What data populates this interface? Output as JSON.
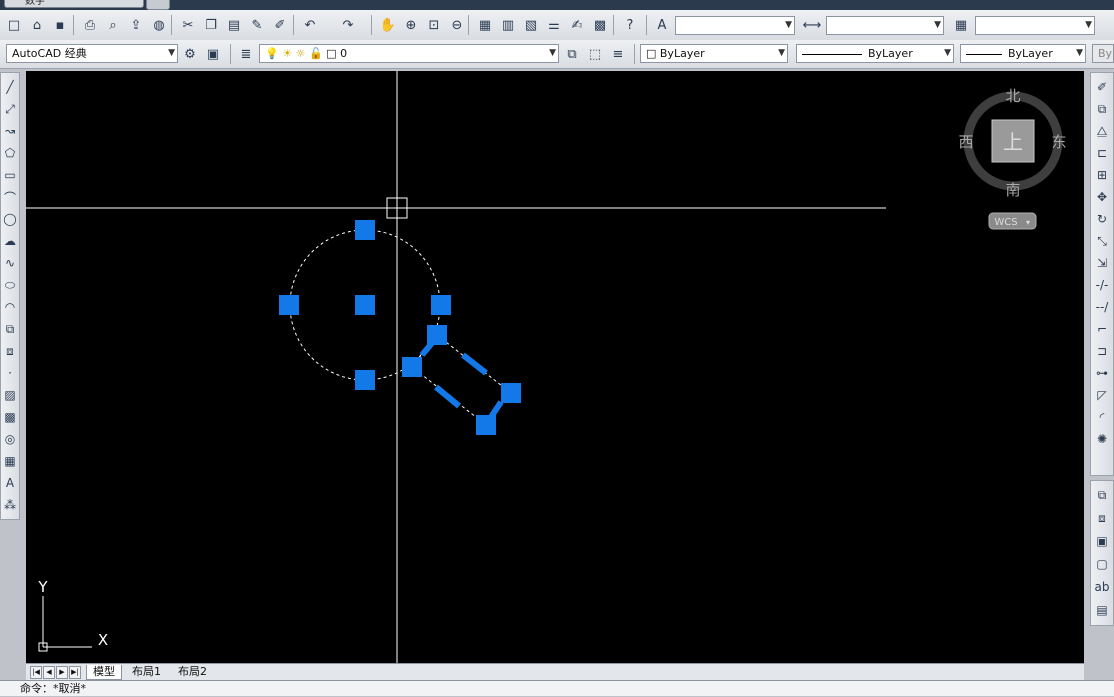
{
  "window": {
    "doc_tab_label": "数字"
  },
  "toolbar1": {
    "icons": [
      "new-file-icon",
      "open-file-icon",
      "save-icon",
      "print-icon",
      "print-preview-icon",
      "publish-icon",
      "3d-dwf-icon",
      "cut-icon",
      "copy-icon",
      "paste-icon",
      "match-properties-icon",
      "block-editor-icon",
      "undo-icon",
      "redo-icon",
      "pan-icon",
      "zoom-realtime-icon",
      "zoom-window-icon",
      "zoom-previous-icon",
      "properties-icon",
      "design-center-icon",
      "tool-palettes-icon",
      "sheet-set-icon",
      "markup-icon",
      "quickcalc-icon",
      "help-icon"
    ],
    "text_style_value": "",
    "dim_style_value": "",
    "table_style_value": ""
  },
  "toolbar2": {
    "workspace_value": "AutoCAD 经典",
    "layer_value": "0",
    "color_value": "ByLayer",
    "linetype_value": "ByLayer",
    "lineweight_value": "ByLayer",
    "plotstyle_value": "Byl"
  },
  "draw_tools": [
    "line-icon",
    "construction-line-icon",
    "polyline-icon",
    "polygon-icon",
    "rectangle-icon",
    "arc-icon",
    "circle-icon",
    "revision-cloud-icon",
    "spline-icon",
    "ellipse-icon",
    "ellipse-arc-icon",
    "insert-block-icon",
    "make-block-icon",
    "point-icon",
    "hatch-icon",
    "gradient-icon",
    "region-icon",
    "table-icon",
    "multiline-text-icon",
    "add-selected-icon"
  ],
  "modify_tools": [
    "erase-icon",
    "copy-object-icon",
    "mirror-icon",
    "offset-icon",
    "array-icon",
    "move-icon",
    "rotate-icon",
    "scale-icon",
    "stretch-icon",
    "trim-icon",
    "extend-icon",
    "break-at-point-icon",
    "break-icon",
    "join-icon",
    "chamfer-icon",
    "fillet-icon",
    "explode-icon"
  ],
  "draw_order_tools": [
    "bring-to-front-icon",
    "send-to-back-icon",
    "bring-above-icon",
    "send-under-icon",
    "text-above-icon",
    "hatch-back-icon"
  ],
  "viewcube": {
    "north": "北",
    "south": "南",
    "west": "西",
    "east": "东",
    "top": "上",
    "wcs": "WCS"
  },
  "ucs": {
    "x_label": "X",
    "y_label": "Y"
  },
  "layout_tabs": [
    "模型",
    "布局1",
    "布局2"
  ],
  "command_line": "命令：*取消*",
  "colors": {
    "canvas": "#000000",
    "grip": "#1479e8",
    "crosshair": "#ffffff"
  }
}
